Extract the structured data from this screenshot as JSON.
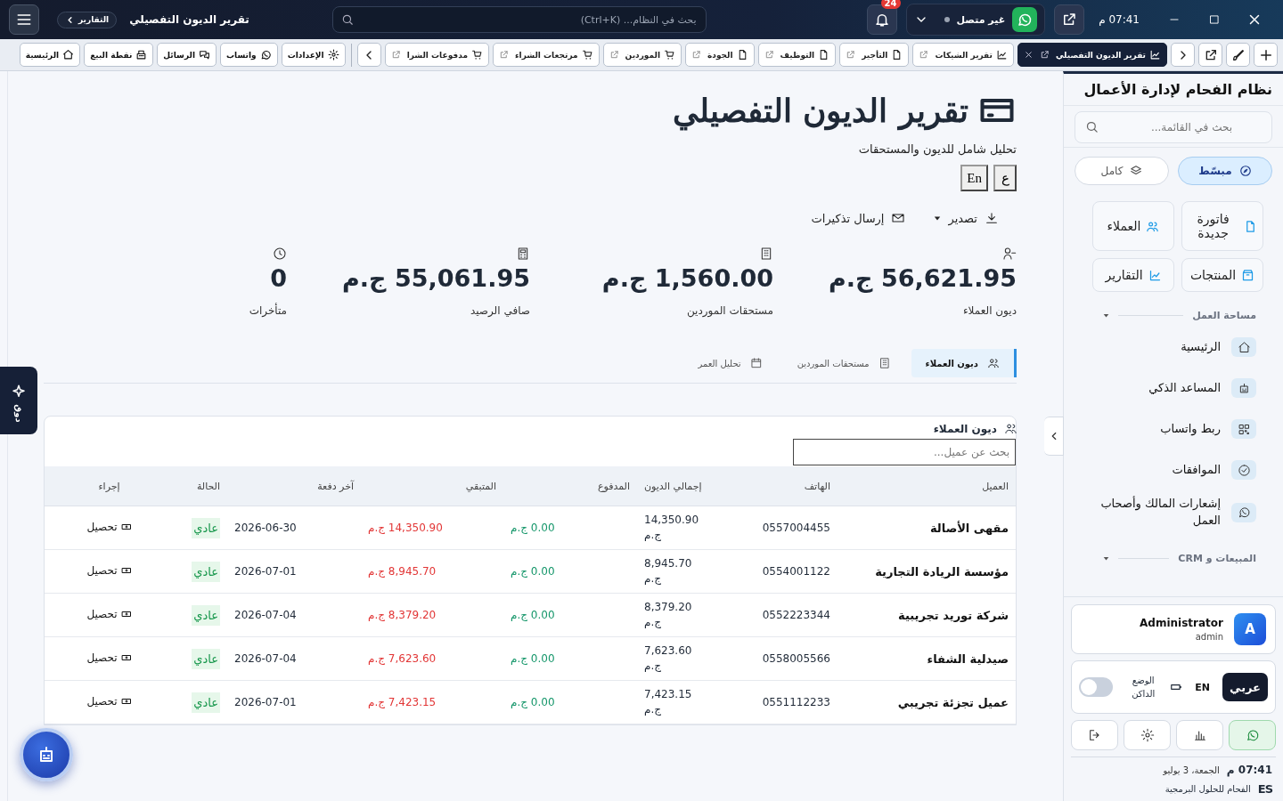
{
  "titlebar": {
    "breadcrumb": "التقارير",
    "title": "تقرير الديون التفصيلي",
    "search_placeholder": "بحث في النظام... (Ctrl+K)",
    "notifications": "24",
    "whatsapp": {
      "status": "غير متصل",
      "connected": false
    },
    "time": "07:41 م"
  },
  "tabs": [
    {
      "label": "تقرير الديون التفصيلي",
      "selected": true
    },
    {
      "label": "تقرير الشيكات",
      "selected": false
    },
    {
      "label": "التأجير",
      "selected": false
    },
    {
      "label": "التوظيف",
      "selected": false
    },
    {
      "label": "الجودة",
      "selected": false
    },
    {
      "label": "الموردين",
      "selected": false
    },
    {
      "label": "مرتجعات الشراء",
      "selected": false
    },
    {
      "label": "مدفوعات الشرا",
      "selected": false
    }
  ],
  "quick_links": [
    "الإعدادات",
    "واتساب",
    "الرسائل",
    "نقطة البيع",
    "الرئيسية"
  ],
  "page": {
    "title": "تقرير الديون التفصيلي",
    "subtitle": "تحليل شامل للديون والمستحقات",
    "languages": [
      "ع",
      "En"
    ],
    "actions": [
      "تصدير",
      "إرسال تذكيرات"
    ]
  },
  "stats": [
    {
      "value": "56,621.95 ج.م",
      "label": "ديون العملاء"
    },
    {
      "value": "1,560.00 ج.م",
      "label": "مستحقات الموردين"
    },
    {
      "value": "55,061.95 ج.م",
      "label": "صافي الرصيد"
    },
    {
      "value": "0",
      "label": "متأخرات"
    }
  ],
  "report_tabs": [
    {
      "label": "ديون العملاء",
      "selected": true
    },
    {
      "label": "مستحقات الموردين",
      "selected": false
    },
    {
      "label": "تحليل العمر",
      "selected": false
    }
  ],
  "table_card": {
    "title": "ديون العملاء",
    "search_placeholder": "بحث عن عميل...",
    "columns": [
      "العميل",
      "الهاتف",
      "إجمالي الديون",
      "المدفوع",
      "المتبقي",
      "آخر دفعة",
      "الحالة",
      "إجراء"
    ],
    "rows": [
      {
        "customer": "مقهى الأصالة",
        "phone": "0557004455",
        "total": "14,350.90 ج.م",
        "paid": "0.00 ج.م",
        "remaining": "14,350.90 ج.م",
        "last_payment": "2026-06-30",
        "status": "عادي",
        "action": "تحصيل"
      },
      {
        "customer": "مؤسسة الريادة التجارية",
        "phone": "0554001122",
        "total": "8,945.70 ج.م",
        "paid": "0.00 ج.م",
        "remaining": "8,945.70 ج.م",
        "last_payment": "2026-07-01",
        "status": "عادي",
        "action": "تحصيل"
      },
      {
        "customer": "شركة توريد تجريبية",
        "phone": "0552223344",
        "total": "8,379.20 ج.م",
        "paid": "0.00 ج.م",
        "remaining": "8,379.20 ج.م",
        "last_payment": "2026-07-04",
        "status": "عادي",
        "action": "تحصيل"
      },
      {
        "customer": "صيدلية الشفاء",
        "phone": "0558005566",
        "total": "7,623.60 ج.م",
        "paid": "0.00 ج.م",
        "remaining": "7,623.60 ج.م",
        "last_payment": "2026-07-04",
        "status": "عادي",
        "action": "تحصيل"
      },
      {
        "customer": "عميل تجزئة تجريبي",
        "phone": "0551112233",
        "total": "7,423.15 ج.م",
        "paid": "0.00 ج.م",
        "remaining": "7,423.15 ج.م",
        "last_payment": "2026-07-01",
        "status": "عادي",
        "action": "تحصيل"
      }
    ]
  },
  "assistant_tab": "دوق",
  "sidebar": {
    "title": "نظام الفحام لإدارة الأعمال",
    "search_placeholder": "بحث في القائمة...",
    "modes": [
      {
        "label": "مبسّط",
        "selected": true
      },
      {
        "label": "كامل",
        "selected": false
      }
    ],
    "shortcuts": [
      "فاتورة جديدة",
      "العملاء",
      "المنتجات",
      "التقارير"
    ],
    "sections": [
      {
        "title": "مساحة العمل",
        "items": [
          "الرئيسية",
          "المساعد الذكي",
          "ربط واتساب",
          "الموافقات",
          "إشعارات المالك وأصحاب العمل"
        ]
      },
      {
        "title": "المبيعات و CRM"
      }
    ],
    "user": {
      "name": "Administrator",
      "role": "admin",
      "avatar": "A"
    },
    "languages": [
      {
        "label": "عربي",
        "selected": true
      },
      {
        "label": "EN",
        "selected": false
      }
    ],
    "dark_mode": {
      "label": "الوضع الداكن",
      "on": false
    },
    "footer_buttons": [
      {
        "selected": true
      },
      {
        "selected": false
      },
      {
        "selected": false
      },
      {
        "selected": false
      }
    ],
    "time": "07:41 م",
    "date": "الجمعة، 3 يوليو",
    "brand_logo": "ES",
    "brand": "الفحام للحلول البرمجية"
  }
}
